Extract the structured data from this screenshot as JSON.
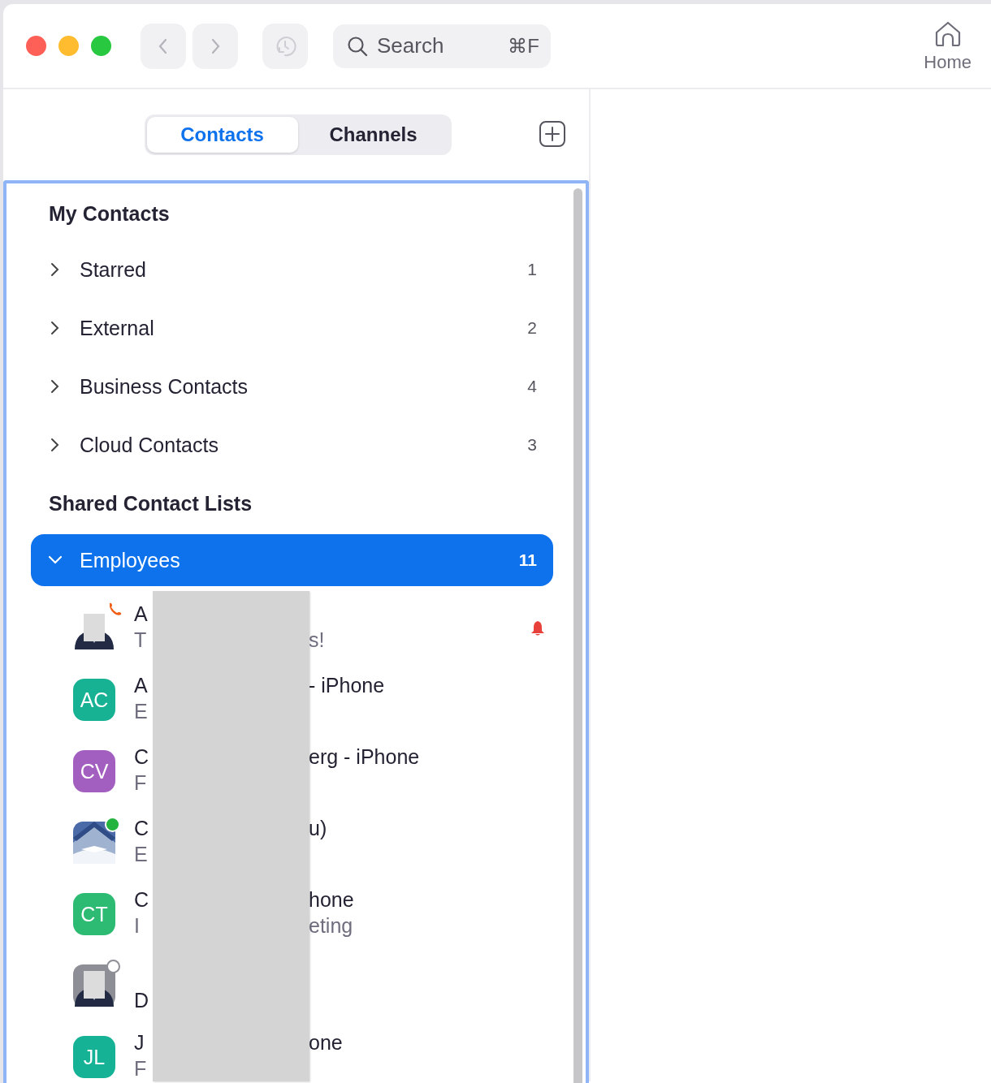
{
  "toolbar": {
    "search": {
      "placeholder": "Search",
      "shortcut": "⌘F"
    },
    "home": {
      "label": "Home"
    }
  },
  "tabs": [
    {
      "label": "Contacts",
      "selected": true
    },
    {
      "label": "Channels",
      "selected": false
    }
  ],
  "sections": [
    {
      "title": "My Contacts",
      "groups": [
        {
          "name": "Starred",
          "count": "1",
          "expanded": false
        },
        {
          "name": "External",
          "count": "2",
          "expanded": false
        },
        {
          "name": "Business Contacts",
          "count": "4",
          "expanded": false
        },
        {
          "name": "Cloud Contacts",
          "count": "3",
          "expanded": false
        }
      ]
    },
    {
      "title": "Shared Contact Lists",
      "groups": [
        {
          "name": "Employees",
          "count": "11",
          "expanded": true,
          "selected": true
        }
      ]
    }
  ],
  "contacts": [
    {
      "on_call": true,
      "name_start": "A",
      "subtitle_start": "T",
      "subtitle_end": "s!",
      "notification": true
    },
    {
      "kind": "initials",
      "initials": "AC",
      "color": "#17b294",
      "name_start": "A",
      "name_end": "- iPhone",
      "subtitle_start": "E",
      "notification": false
    },
    {
      "kind": "initials",
      "initials": "CV",
      "color": "#a35fbf",
      "name_start": "C",
      "name_end": "erg - iPhone",
      "subtitle_start": "F",
      "notification": false
    },
    {
      "kind": "picture",
      "online": true,
      "name_start": "C",
      "name_end": "u)",
      "subtitle_start": "E",
      "notification": false
    },
    {
      "kind": "initials",
      "initials": "CT",
      "color": "#2dbb73",
      "name_start": "C",
      "name_end": "hone",
      "subtitle_start": "I",
      "subtitle_end": "eting",
      "notification": false
    },
    {
      "online": false,
      "name_start": "D",
      "notification": false
    },
    {
      "kind": "initials",
      "initials": "JL",
      "color": "#15b295",
      "name_start": "J",
      "name_end": "one",
      "subtitle_start": "F",
      "notification": false
    }
  ]
}
